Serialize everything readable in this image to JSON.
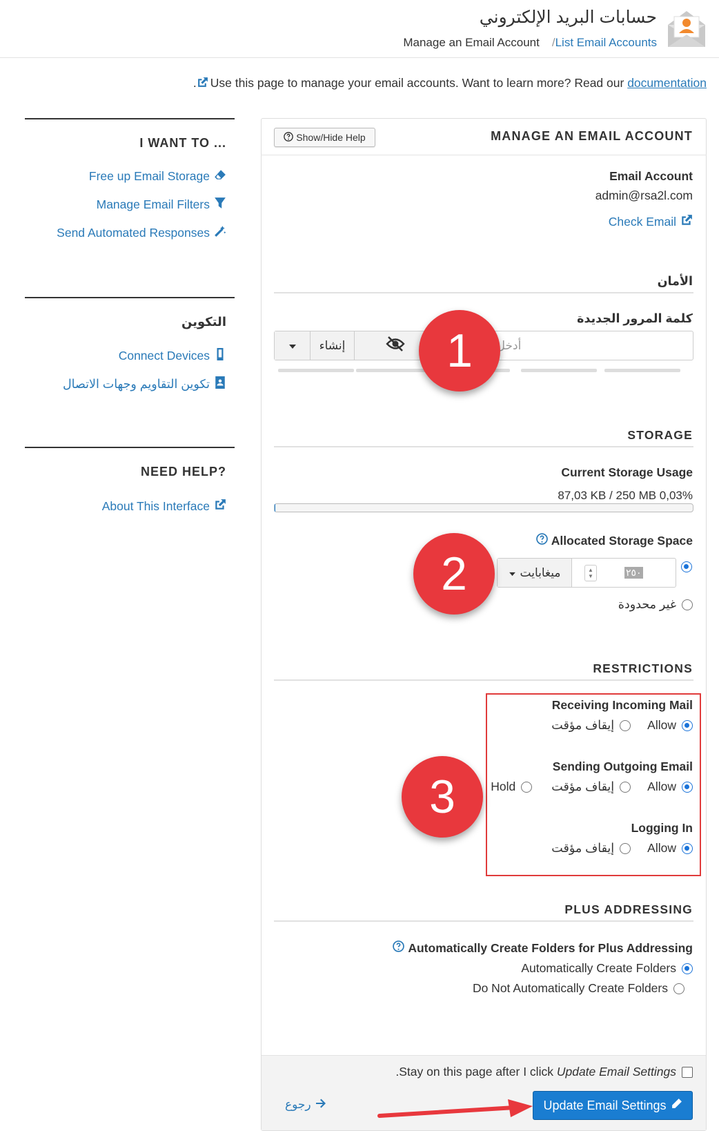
{
  "header": {
    "title": "حسابات البريد الإلكتروني",
    "breadcrumb_parent": "List Email Accounts",
    "breadcrumb_sep": "/",
    "breadcrumb_current": "Manage an Email Account",
    "logo_icon": "email-account-logo-icon"
  },
  "intro": {
    "text": "Use this page to manage your email accounts. Want to learn more? Read our",
    "link": "documentation",
    "suffix": "."
  },
  "sidebar": {
    "want_to": {
      "heading": "I WANT TO ...",
      "items": [
        {
          "label": "Free up Email Storage",
          "icon": "eraser-icon"
        },
        {
          "label": "Manage Email Filters",
          "icon": "filter-icon"
        },
        {
          "label": "Send Automated Responses",
          "icon": "magic-wand-icon"
        }
      ]
    },
    "config": {
      "heading": "التكوين",
      "items": [
        {
          "label": "Connect Devices",
          "icon": "mobile-icon"
        },
        {
          "label": "تكوين التقاويم وجهات الاتصال",
          "icon": "address-book-icon"
        }
      ]
    },
    "help": {
      "heading": "NEED HELP?",
      "items": [
        {
          "label": "About This Interface",
          "icon": "external-link-icon"
        }
      ]
    }
  },
  "panel": {
    "title": "MANAGE AN EMAIL ACCOUNT",
    "help_button": "Show/Hide Help",
    "account_label": "Email Account",
    "account_value": "admin@rsa2l.com",
    "check_email": "Check Email",
    "security": {
      "title": "الأمان",
      "new_password_label": "كلمة المرور الجديدة",
      "password_placeholder": "أدخل كلمة المرور",
      "generate_label": "إنشاء"
    },
    "storage": {
      "title": "STORAGE",
      "usage_label": "Current Storage Usage",
      "usage_value": "87,03 KB / 250 MB 0,03%",
      "usage_fraction": 0.0003,
      "allocated_label": "Allocated Storage Space",
      "allocated_value": "٢٥٠",
      "allocated_unit": "ميغابايت",
      "unlimited_label": "غير محدودة",
      "selected": "value"
    },
    "restrictions": {
      "title": "RESTRICTIONS",
      "receiving": {
        "label": "Receiving Incoming Mail",
        "allow": "Allow",
        "suspend": "إيقاف مؤقت",
        "selected": "allow"
      },
      "sending": {
        "label": "Sending Outgoing Email",
        "allow": "Allow",
        "suspend": "إيقاف مؤقت",
        "hold": "Hold",
        "selected": "allow"
      },
      "login": {
        "label": "Logging In",
        "allow": "Allow",
        "suspend": "إيقاف مؤقت",
        "selected": "allow"
      }
    },
    "plus": {
      "title": "PLUS ADDRESSING",
      "label": "Automatically Create Folders for Plus Addressing",
      "option_auto": "Automatically Create Folders",
      "option_no": "Do Not Automatically Create Folders",
      "selected": "auto"
    },
    "footer": {
      "stay_prefix": "Stay on this page after I click",
      "stay_em": "Update Email Settings",
      "stay_suffix": ".",
      "update_button": "Update Email Settings",
      "back": "رجوع"
    }
  },
  "annotations": [
    "1",
    "2",
    "3"
  ],
  "colors": {
    "accent": "#1a7dd1",
    "link": "#2a7ab8",
    "badge": "#e8383d",
    "highlight_box": "#e03b3b"
  }
}
